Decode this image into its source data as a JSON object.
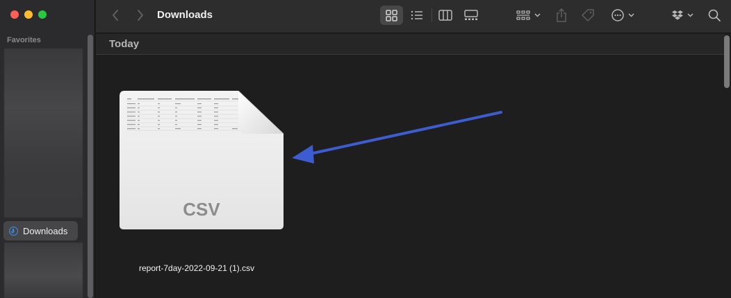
{
  "window": {
    "title": "Downloads"
  },
  "sidebar": {
    "section_label": "Favorites",
    "selected_item": "Downloads"
  },
  "toolbar": {
    "icons": [
      "back-icon",
      "forward-icon",
      "icon-view-icon",
      "list-view-icon",
      "column-view-icon",
      "gallery-view-icon",
      "group-icon",
      "share-icon",
      "tag-icon",
      "more-actions-icon",
      "dropbox-icon",
      "search-icon"
    ]
  },
  "content": {
    "group_label": "Today",
    "file": {
      "type_label": "CSV",
      "name": "report-7day-2022-09-21 (1).csv"
    }
  },
  "colors": {
    "window_bg": "#1e1e1e",
    "sidebar_bg": "#2b2b2e",
    "toolbar_bg": "#2d2d2d",
    "accent_blue": "#3b8ff0",
    "arrow_annotation": "#3d5ccf"
  }
}
